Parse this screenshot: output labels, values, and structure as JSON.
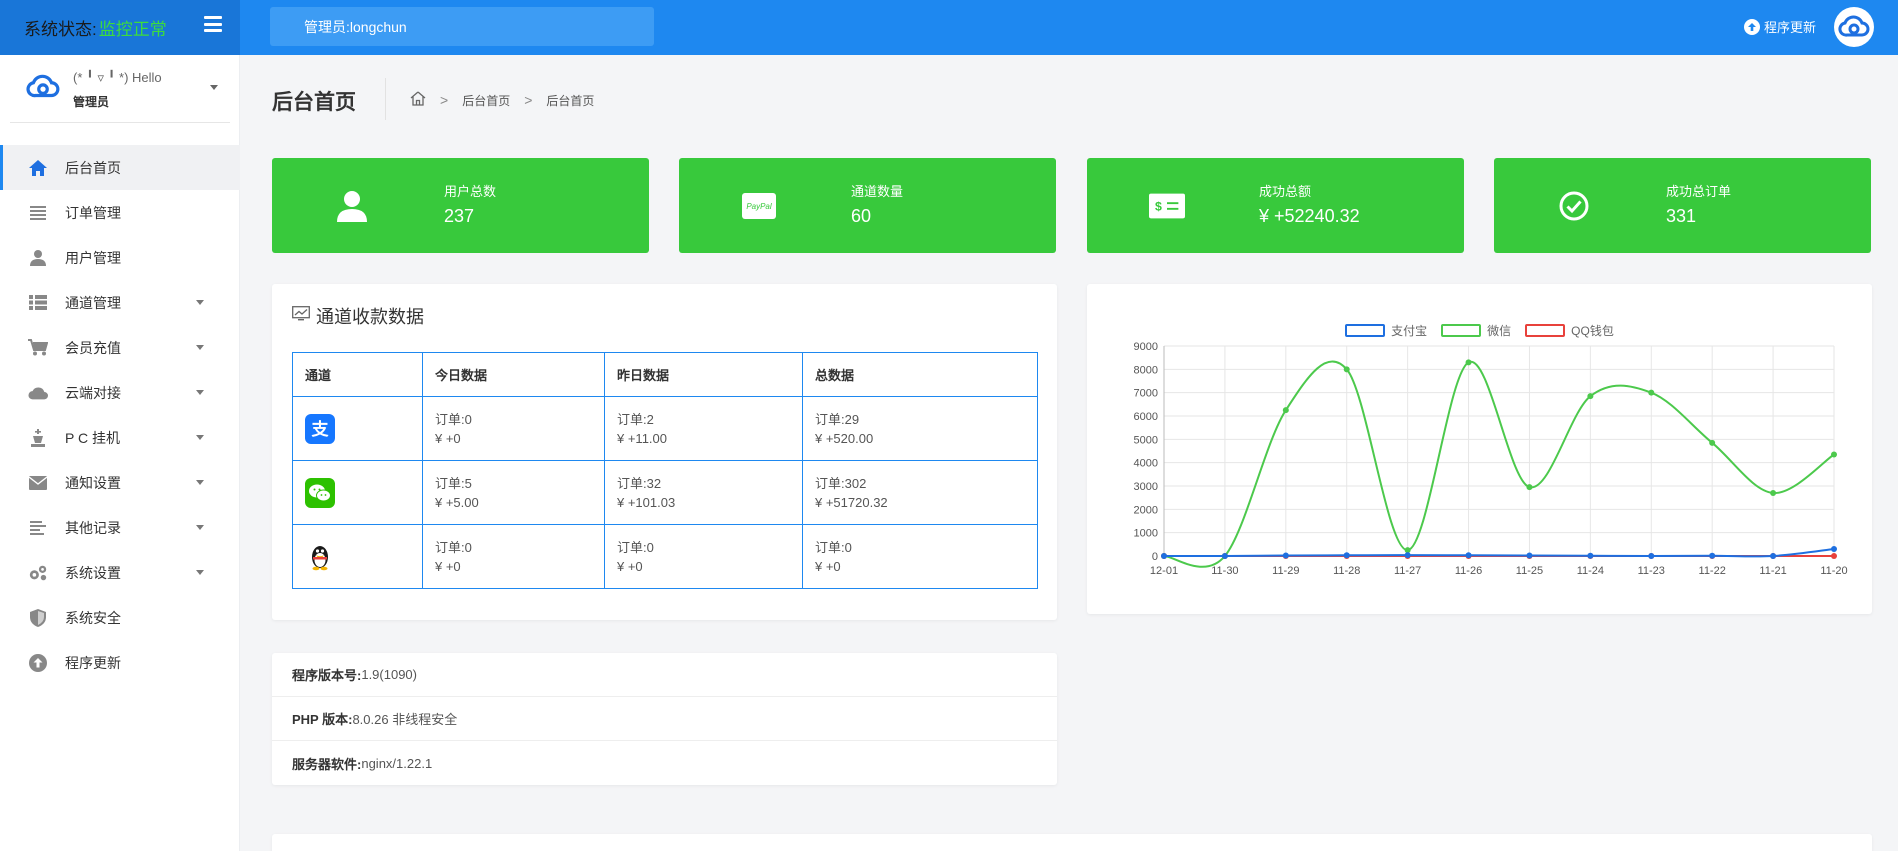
{
  "topbar": {
    "status_label": "系统状态:",
    "status_value": "监控正常",
    "admin_label": "管理员:longchun",
    "update_label": "程序更新"
  },
  "sidebar": {
    "user_hello": "(* ╹ ▿ ╹ *) Hello",
    "user_role": "管理员",
    "items": [
      {
        "label": "后台首页",
        "icon": "home-icon",
        "active": true
      },
      {
        "label": "订单管理",
        "icon": "list-icon"
      },
      {
        "label": "用户管理",
        "icon": "user-icon"
      },
      {
        "label": "通道管理",
        "icon": "grid-list-icon",
        "caret": true
      },
      {
        "label": "会员充值",
        "icon": "cart-icon",
        "caret": true
      },
      {
        "label": "云端对接",
        "icon": "cloud-icon",
        "caret": true
      },
      {
        "label": "P C 挂机",
        "icon": "chess-king-icon",
        "caret": true
      },
      {
        "label": "通知设置",
        "icon": "envelope-icon",
        "caret": true
      },
      {
        "label": "其他记录",
        "icon": "align-left-icon",
        "caret": true
      },
      {
        "label": "系统设置",
        "icon": "gears-icon",
        "caret": true
      },
      {
        "label": "系统安全",
        "icon": "shield-icon"
      },
      {
        "label": "程序更新",
        "icon": "arrow-up-circle-icon"
      }
    ]
  },
  "header": {
    "title": "后台首页",
    "breadcrumb": [
      "后台首页",
      "后台首页"
    ]
  },
  "stats": [
    {
      "label": "用户总数",
      "value": "237",
      "icon": "user-icon"
    },
    {
      "label": "通道数量",
      "value": "60",
      "icon": "paypal-card-icon"
    },
    {
      "label": "成功总额",
      "value": "¥ +52240.32",
      "icon": "money-bill-icon"
    },
    {
      "label": "成功总订单",
      "value": "331",
      "icon": "check-circle-icon"
    }
  ],
  "channel_panel": {
    "title": "通道收款数据",
    "headers": [
      "通道",
      "今日数据",
      "昨日数据",
      "总数据"
    ],
    "rows": [
      {
        "logo": "alipay-icon",
        "today": [
          "订单:0",
          "¥ +0"
        ],
        "yesterday": [
          "订单:2",
          "¥ +11.00"
        ],
        "total": [
          "订单:29",
          "¥ +520.00"
        ]
      },
      {
        "logo": "wechat-icon",
        "today": [
          "订单:5",
          "¥ +5.00"
        ],
        "yesterday": [
          "订单:32",
          "¥ +101.03"
        ],
        "total": [
          "订单:302",
          "¥ +51720.32"
        ]
      },
      {
        "logo": "qq-penguin-icon",
        "today": [
          "订单:0",
          "¥ +0"
        ],
        "yesterday": [
          "订单:0",
          "¥ +0"
        ],
        "total": [
          "订单:0",
          "¥ +0"
        ]
      }
    ]
  },
  "sysinfo": [
    {
      "label": "程序版本号:",
      "value": "1.9(1090)"
    },
    {
      "label": "PHP 版本:",
      "value": "8.0.26 非线程安全"
    },
    {
      "label": "服务器软件:",
      "value": "nginx/1.22.1"
    }
  ],
  "colors": {
    "accent": "#1e88f0",
    "green": "#38c93c",
    "alipay": "#1677ff",
    "wechat": "#2dc100",
    "qq": "#e8413b"
  },
  "chart_data": {
    "type": "line",
    "x": [
      "12-01",
      "11-30",
      "11-29",
      "11-28",
      "11-27",
      "11-26",
      "11-25",
      "11-24",
      "11-23",
      "11-22",
      "11-21",
      "11-20"
    ],
    "series": [
      {
        "name": "支付宝",
        "color": "#1e6fe0",
        "values": [
          0,
          0,
          20,
          30,
          40,
          30,
          20,
          10,
          0,
          10,
          0,
          300
        ]
      },
      {
        "name": "微信",
        "color": "#4cc94c",
        "values": [
          0,
          0,
          6250,
          8000,
          250,
          8300,
          2950,
          6850,
          7000,
          4850,
          2700,
          4350
        ]
      },
      {
        "name": "QQ钱包",
        "color": "#e8413b",
        "values": [
          0,
          0,
          0,
          0,
          0,
          0,
          0,
          0,
          0,
          0,
          0,
          0
        ]
      }
    ],
    "ylim": [
      0,
      9000
    ],
    "yticks": [
      0,
      1000,
      2000,
      3000,
      4000,
      5000,
      6000,
      7000,
      8000,
      9000
    ],
    "grid": true,
    "legend": "top"
  }
}
